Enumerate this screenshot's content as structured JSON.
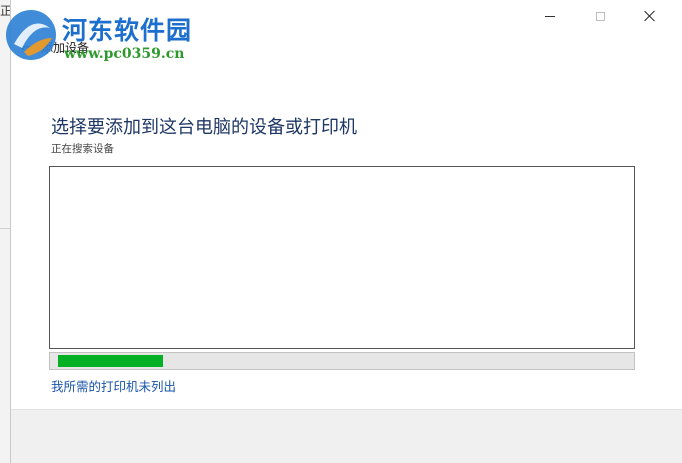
{
  "background": {
    "glyph": "正"
  },
  "window": {
    "title": "添加设备",
    "controls": {
      "minimize_icon": "minimize-icon",
      "maximize_icon": "maximize-icon",
      "close_icon": "close-icon"
    },
    "back_icon": "back-arrow-icon"
  },
  "watermark": {
    "name": "河东软件园",
    "url": "www.pc0359.cn",
    "colors": {
      "name": "#1c6fcd",
      "url": "#2e9a2e"
    }
  },
  "main": {
    "heading": "选择要添加到这台电脑的设备或打印机",
    "status": "正在搜索设备",
    "device_list": [],
    "progress": {
      "fraction": 0.185,
      "color": "#06b025"
    },
    "printer_not_listed_link": "我所需的打印机未列出"
  },
  "colors": {
    "heading": "#1e3764",
    "link": "#1a56a8",
    "footer_bg": "#f0f0f0"
  }
}
